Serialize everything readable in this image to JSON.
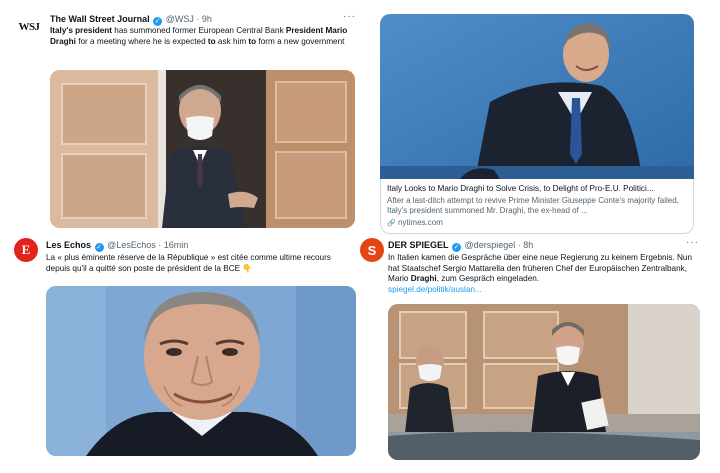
{
  "wsj": {
    "avatar_text": "WSJ",
    "name": "The Wall Street Journal",
    "handle": "@WSJ",
    "time": "9h",
    "text_parts": [
      {
        "t": "Italy's president",
        "b": true
      },
      {
        "t": " has summoned former European Central Bank ",
        "b": false
      },
      {
        "t": "President Mario Draghi",
        "b": true
      },
      {
        "t": " for a meeting where he is expected ",
        "b": false
      },
      {
        "t": "to",
        "b": true
      },
      {
        "t": " ask him ",
        "b": false
      },
      {
        "t": "to",
        "b": true
      },
      {
        "t": " form a new government",
        "b": false
      }
    ]
  },
  "nyt": {
    "card_title": "Italy Looks to Mario Draghi to Solve Crisis, to Delight of Pro-E.U. Politici...",
    "card_desc": "After a last-ditch attempt to revive Prime Minister Giuseppe Conte's majority failed, Italy's president summoned Mr. Draghi, the ex-head of ...",
    "card_domain": "nytimes.com"
  },
  "lesechos": {
    "avatar_text": "E",
    "name": "Les Echos",
    "handle": "@LesEchos",
    "time": "16min",
    "text": "La « plus éminente réserve de la République » est citée comme ultime recours depuis qu'il a quitté son poste de président de la BCE 👇"
  },
  "spiegel": {
    "avatar_text": "S",
    "name": "DER SPIEGEL",
    "handle": "@derspiegel",
    "time": "8h",
    "text_before": "In Italien kamen die Gespräche über eine neue Regierung zu keinem Ergebnis. Nun hat Staatschef Sergio Mattarella den früheren Chef der Europäischen Zentralbank, Mario ",
    "text_bold": "Draghi",
    "text_after": ", zum Gespräch eingeladen.",
    "link": "spiegel.de/politik/auslan..."
  },
  "separator": "·",
  "more": "···",
  "verified_glyph": "✓",
  "colors": {
    "verified": "#1d9bf0",
    "link": "#1d9bf0",
    "lesechos_red": "#e2231a",
    "spiegel_orange": "#e64415"
  }
}
